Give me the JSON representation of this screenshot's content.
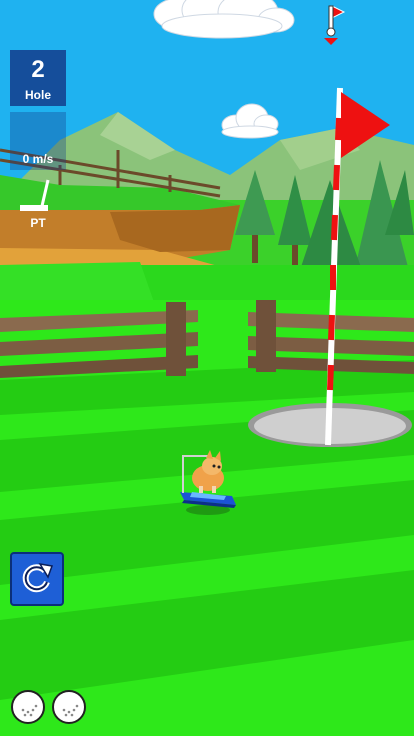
{
  "hud": {
    "hole_number": "2",
    "hole_label": "Hole",
    "speed": "0 m/s",
    "club": "PT"
  },
  "icons": {
    "reset": "restart-arrow-icon",
    "balls": [
      "golf-ball-icon",
      "golf-ball-icon"
    ],
    "flag_indicator": "flag-marker-icon"
  },
  "colors": {
    "sky": "#1fb2f0",
    "grass_light": "#2ee81a",
    "grass_dark": "#21c80f",
    "flag": "#ee1111",
    "hud_panel": "#1e4aa0"
  }
}
